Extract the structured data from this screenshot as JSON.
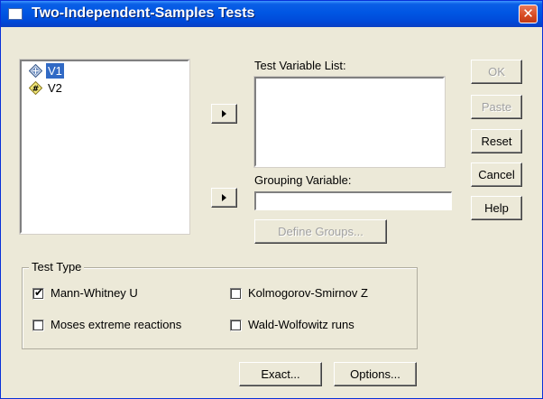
{
  "window": {
    "title": "Two-Independent-Samples Tests",
    "close_glyph": "✕"
  },
  "variables": [
    {
      "label": "V1",
      "icon": "scale-variable-icon",
      "selected": true
    },
    {
      "label": "V2",
      "icon": "ordinal-variable-icon",
      "selected": false
    }
  ],
  "test_variable_list": {
    "label": "Test Variable List:",
    "items": []
  },
  "grouping_variable": {
    "label": "Grouping Variable:",
    "value": ""
  },
  "buttons": {
    "ok": "OK",
    "paste": "Paste",
    "reset": "Reset",
    "cancel": "Cancel",
    "help": "Help",
    "define_groups": "Define Groups...",
    "exact": "Exact...",
    "options": "Options..."
  },
  "test_type": {
    "legend": "Test Type",
    "options": [
      {
        "label": "Mann-Whitney U",
        "checked": true
      },
      {
        "label": "Kolmogorov-Smirnov Z",
        "checked": false
      },
      {
        "label": "Moses extreme reactions",
        "checked": false
      },
      {
        "label": "Wald-Wolfowitz runs",
        "checked": false
      }
    ]
  },
  "colors": {
    "titlebar": "#0056e3",
    "selection": "#316ac5",
    "dialog_bg": "#ece9d8"
  }
}
